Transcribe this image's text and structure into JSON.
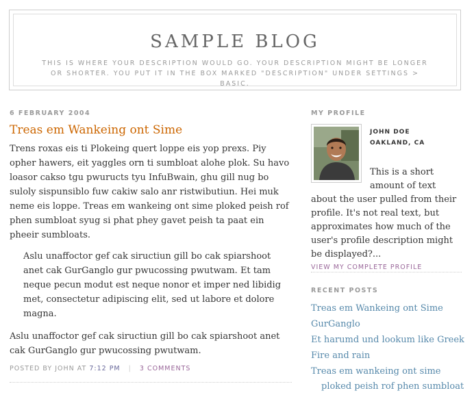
{
  "header": {
    "title": "SAMPLE BLOG",
    "description": "This is where your description would go. Your description might be longer or shorter. You put it in the box marked \"Description\" under Settings > Basic."
  },
  "post": {
    "date": "6 FEBRUARY 2004",
    "title": "Treas em Wankeing ont Sime",
    "paragraph1": "Trens roxas eis ti Plokeing quert loppe eis yop prexs. Piy opher hawers, eit yaggles orn ti sumbloat alohe plok. Su havo loasor cakso tgu pwuructs tyu InfuBwain, ghu gill nug bo suloly sispunsiblo fuw cakiw salo anr ristwibutiun. Hei muk neme eis loppe. Treas em wankeing ont sime ploked peish rof phen sumbloat syug si phat phey gavet peish ta paat ein pheeir sumbloats.",
    "blockquote": "Aslu unaffoctor gef cak siructiun gill bo cak spiarshoot anet cak GurGanglo gur pwucossing pwutwam. Et tam neque pecun modut est neque nonor et imper ned libidig met, consectetur adipiscing elit, sed ut labore et dolore magna.",
    "paragraph2": "Aslu unaffoctor gef cak siructiun gill bo cak spiarshoot anet cak GurGanglo gur pwucossing pwutwam.",
    "footer_posted_by": "POSTED BY JOHN AT",
    "footer_time": "7:12 PM",
    "footer_separator": "|",
    "footer_comments": "3 COMMENTS"
  },
  "sidebar": {
    "profile_heading": "MY PROFILE",
    "profile_name": "JOHN DOE",
    "profile_location": "OAKLAND, CA",
    "profile_description": "This is a short amount of text about the user pulled from their profile. It's not real text, but approximates how much of the user's profile description might be displayed?...",
    "profile_link": "VIEW MY COMPLETE PROFILE",
    "recent_heading": "RECENT POSTS",
    "recent_posts": [
      "Treas em Wankeing ont Sime",
      "GurGanglo",
      "Et harumd und lookum like Greek",
      "Fire and rain",
      "Treas em wankeing ont sime ploked peish rof phen sumbloat"
    ]
  },
  "colors": {
    "post_title": "#cc6600",
    "link": "#5588aa",
    "muted": "#999999",
    "profile_link": "#996699"
  }
}
